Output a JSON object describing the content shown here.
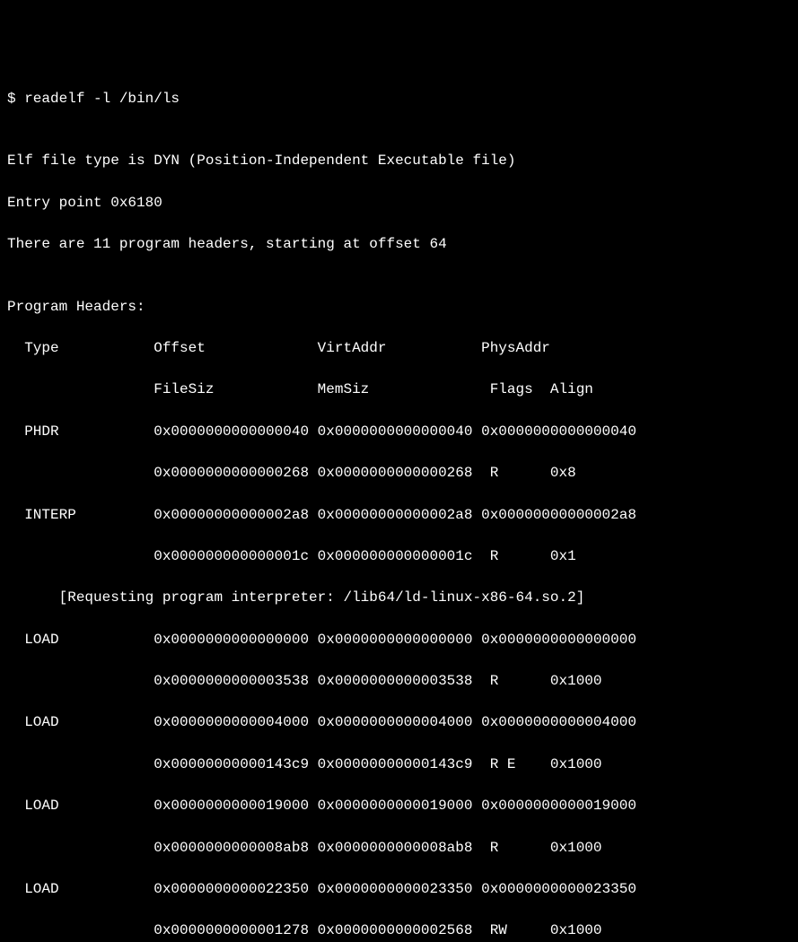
{
  "prompt": "$ readelf -l /bin/ls",
  "blank": "",
  "info_type": "Elf file type is DYN (Position-Independent Executable file)",
  "info_entry": "Entry point 0x6180",
  "info_count": "There are 11 program headers, starting at offset 64",
  "section_heading": "Program Headers:",
  "hdr1": "  Type           Offset             VirtAddr           PhysAddr",
  "hdr2": "                 FileSiz            MemSiz              Flags  Align",
  "rows": [
    "  PHDR           0x0000000000000040 0x0000000000000040 0x0000000000000040",
    "                 0x0000000000000268 0x0000000000000268  R      0x8",
    "  INTERP         0x00000000000002a8 0x00000000000002a8 0x00000000000002a8",
    "                 0x000000000000001c 0x000000000000001c  R      0x1",
    "      [Requesting program interpreter: /lib64/ld-linux-x86-64.so.2]",
    "  LOAD           0x0000000000000000 0x0000000000000000 0x0000000000000000",
    "                 0x0000000000003538 0x0000000000003538  R      0x1000",
    "  LOAD           0x0000000000004000 0x0000000000004000 0x0000000000004000",
    "                 0x00000000000143c9 0x00000000000143c9  R E    0x1000",
    "  LOAD           0x0000000000019000 0x0000000000019000 0x0000000000019000",
    "                 0x0000000000008ab8 0x0000000000008ab8  R      0x1000",
    "  LOAD           0x0000000000022350 0x0000000000023350 0x0000000000023350",
    "                 0x0000000000001278 0x0000000000002568  RW     0x1000"
  ]
}
